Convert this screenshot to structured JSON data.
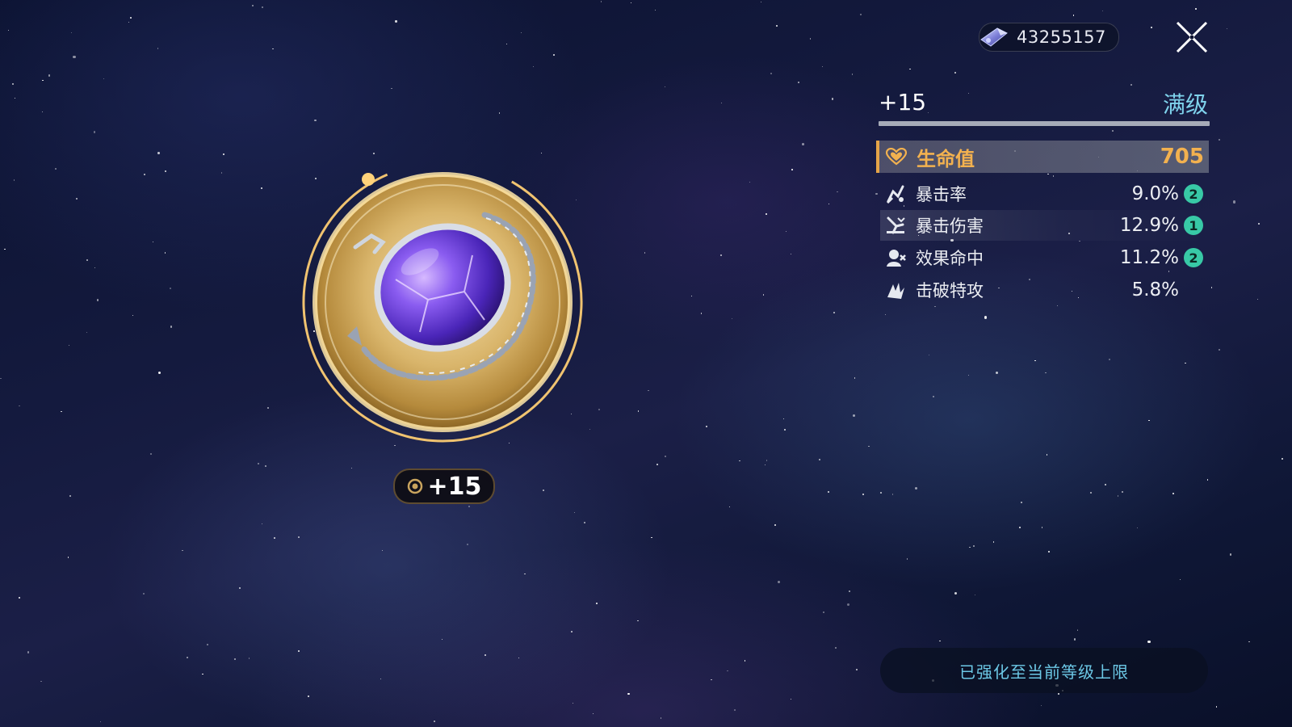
{
  "currency": {
    "icon": "currency-gem-icon",
    "amount": "43255157"
  },
  "close": {
    "icon": "close-icon"
  },
  "relic": {
    "level": "+15"
  },
  "panel": {
    "level": "+15",
    "max_label": "满级",
    "main_stat": {
      "icon": "heart-icon",
      "name": "生命值",
      "value": "705",
      "color": "#f2b14f"
    },
    "sub_stats": [
      {
        "icon": "crit-rate-icon",
        "name": "暴击率",
        "value": "9.0%",
        "rolls": "2"
      },
      {
        "icon": "crit-dmg-icon",
        "name": "暴击伤害",
        "value": "12.9%",
        "rolls": "1"
      },
      {
        "icon": "effect-hit-icon",
        "name": "效果命中",
        "value": "11.2%",
        "rolls": "2"
      },
      {
        "icon": "break-effect-icon",
        "name": "击破特攻",
        "value": "5.8%",
        "rolls": ""
      }
    ]
  },
  "footer": {
    "button_label": "已强化至当前等级上限"
  },
  "colors": {
    "accent_cyan": "#7fd3ec",
    "stat_gold": "#f2b14f",
    "roll_badge": "#38c9a6"
  }
}
